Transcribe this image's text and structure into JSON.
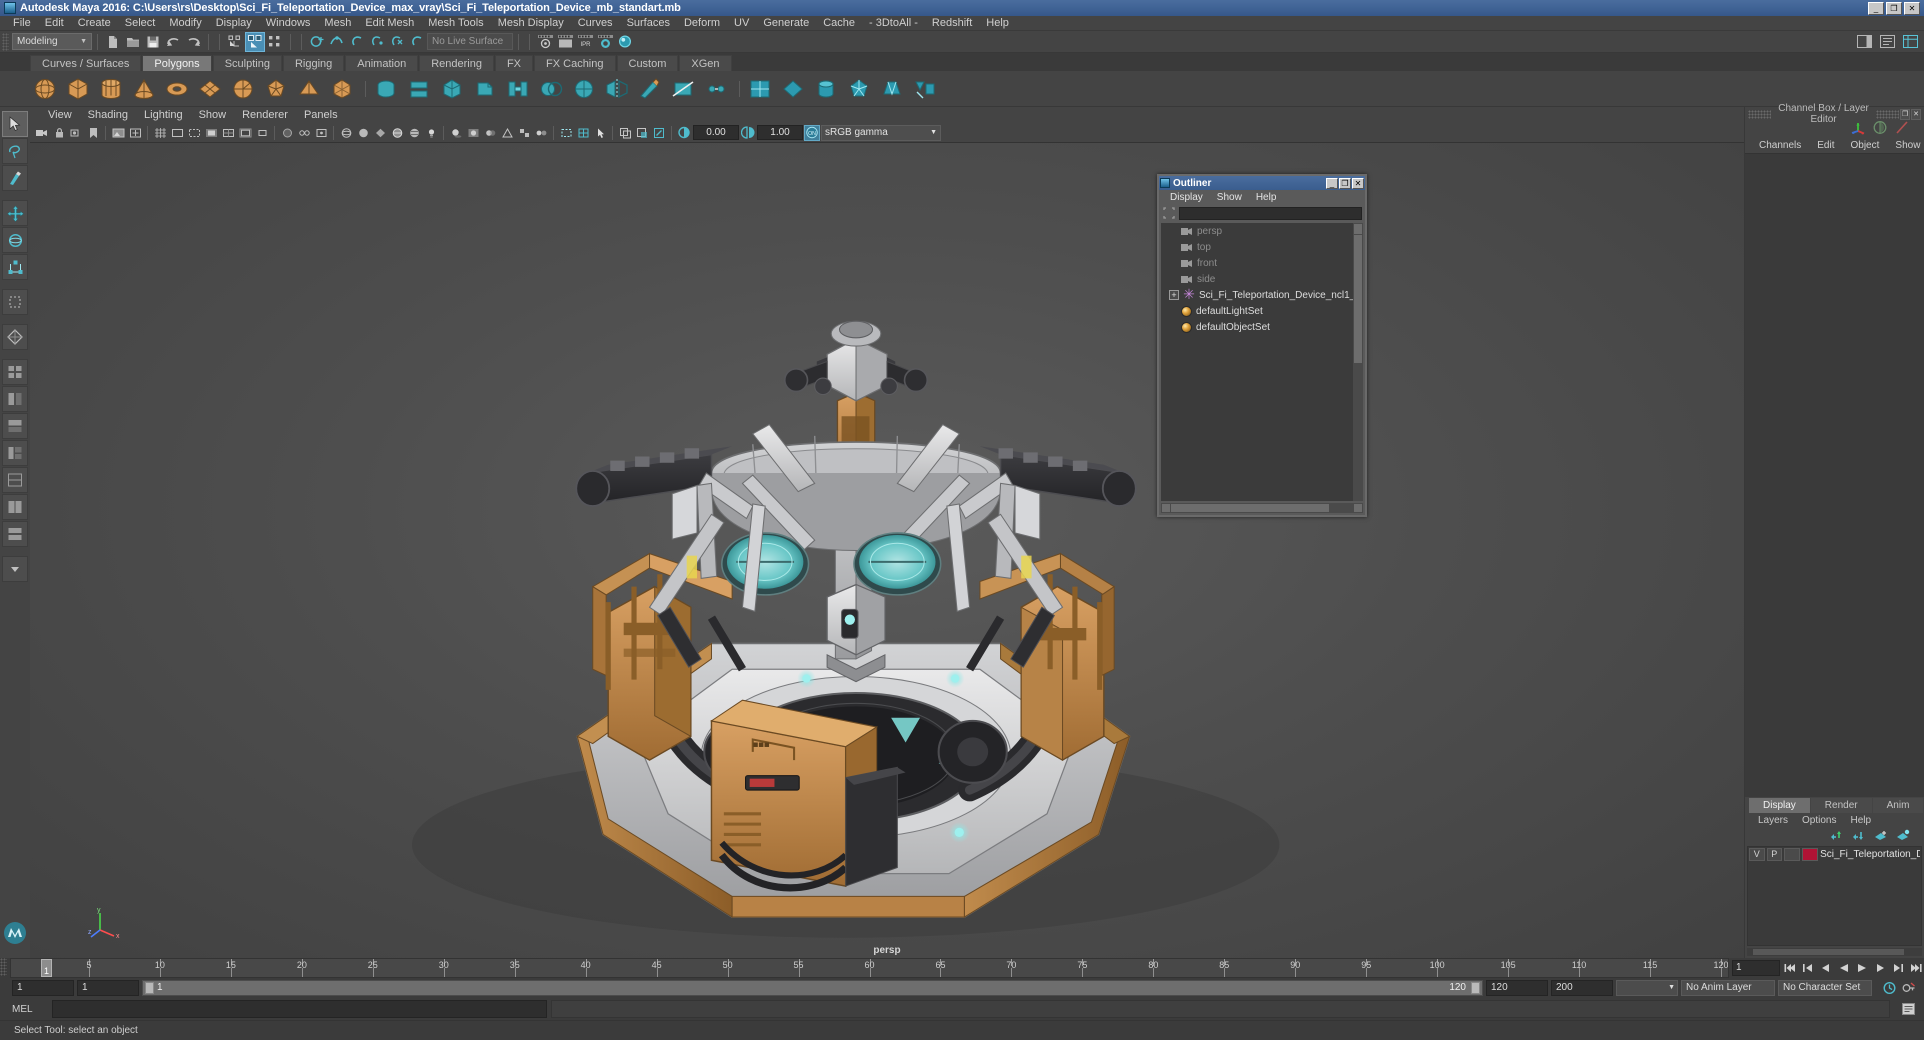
{
  "window": {
    "title": "Autodesk Maya 2016: C:\\Users\\rs\\Desktop\\Sci_Fi_Teleportation_Device_max_vray\\Sci_Fi_Teleportation_Device_mb_standart.mb",
    "buttons": [
      "_",
      "❐",
      "✕"
    ],
    "icon": "maya-app-icon"
  },
  "main_menu": {
    "items": [
      "File",
      "Edit",
      "Create",
      "Select",
      "Modify",
      "Display",
      "Windows",
      "Mesh",
      "Edit Mesh",
      "Mesh Tools",
      "Mesh Display",
      "Curves",
      "Surfaces",
      "Deform",
      "UV",
      "Generate",
      "Cache",
      "- 3DtoAll -",
      "Redshift",
      "Help"
    ]
  },
  "status_toolbar": {
    "menuset": {
      "value": "Modeling",
      "arrow": "▼"
    },
    "live_surface": {
      "value": "No Live Surface"
    },
    "icons": [
      "new-scene-icon",
      "open-scene-icon",
      "save-scene-icon",
      "undo-icon",
      "redo-icon",
      "select-by-hierarchy-icon",
      "select-by-object-icon",
      "select-by-component-icon",
      "snap-to-grid-icon",
      "snap-to-curve-icon",
      "snap-to-point-icon",
      "snap-to-projected-center-icon",
      "snap-to-view-plane-icon",
      "make-live-icon",
      "render-view-icon",
      "render-sequence-icon",
      "ipr-render-icon",
      "render-settings-icon",
      "hypershade-icon"
    ],
    "right_icons": [
      "sidebar-toggle-icon",
      "attribute-editor-icon",
      "tool-settings-icon",
      "channel-box-icon"
    ]
  },
  "shelf": {
    "tabs": [
      "Curves / Surfaces",
      "Polygons",
      "Sculpting",
      "Rigging",
      "Animation",
      "Rendering",
      "FX",
      "FX Caching",
      "Custom",
      "XGen"
    ],
    "active_tab": "Polygons",
    "icons": [
      "poly-sphere-icon",
      "poly-cube-icon",
      "poly-cylinder-icon",
      "poly-cone-icon",
      "poly-torus-icon",
      "poly-plane-icon",
      "poly-disc-icon",
      "poly-platonic-icon",
      "poly-pyramid-icon",
      "poly-prism-icon",
      "combine-icon",
      "separate-icon",
      "extrude-icon",
      "bevel-icon",
      "bridge-icon",
      "booleans-icon",
      "smooth-icon",
      "mirror-icon",
      "sculpt-icon",
      "soft-select-icon",
      "poly-fill-hole-icon",
      "multi-cut-icon",
      "target-weld-icon",
      "quad-draw-icon",
      "crease-icon",
      "insert-edge-loop-icon",
      "offset-edge-loop-icon",
      "uv-editor-icon",
      "uv-planar-icon",
      "uv-cylindrical-icon",
      "uv-spherical-icon",
      "uv-automatic-icon",
      "uv-unfold-icon",
      "uv-layout-icon"
    ]
  },
  "toolbox": {
    "items": [
      {
        "name": "select-tool",
        "selected": true
      },
      {
        "name": "lasso-select-tool",
        "selected": false
      },
      {
        "name": "paint-select-tool",
        "selected": false
      },
      {
        "name": "move-tool",
        "selected": false
      },
      {
        "name": "rotate-tool",
        "selected": false
      },
      {
        "name": "scale-tool",
        "selected": false
      },
      {
        "name": "last-tool-used",
        "selected": false
      },
      {
        "name": "single-perspective-view-layout",
        "selected": false
      },
      {
        "name": "four-view-layout",
        "selected": false
      },
      {
        "name": "persp-outliner-layout",
        "selected": false
      },
      {
        "name": "persp-graph-layout",
        "selected": false
      },
      {
        "name": "persp-hypershade-layout",
        "selected": false
      },
      {
        "name": "persp-uv-layout",
        "selected": false
      },
      {
        "name": "two-pane-side-layout",
        "selected": false
      },
      {
        "name": "two-pane-stacked-layout",
        "selected": false
      },
      {
        "name": "more-layouts",
        "selected": false
      }
    ]
  },
  "viewport": {
    "panel_menu": [
      "View",
      "Shading",
      "Lighting",
      "Show",
      "Renderer",
      "Panels"
    ],
    "camera_label": "persp",
    "toolbar": {
      "exposure_value": "0.00",
      "gamma_value": "1.00",
      "color_management": "sRGB gamma",
      "cm_arrow": "▼",
      "toggle_on_label": "ON",
      "icons": [
        "select-camera-icon",
        "lock-camera-icon",
        "camera-attributes-icon",
        "bookmarks-icon",
        "image-plane-icon",
        "two-d-pan-zoom-icon",
        "grid-toggle-icon",
        "film-gate-icon",
        "resolution-gate-icon",
        "gate-mask-icon",
        "field-chart-icon",
        "safe-action-icon",
        "safe-title-icon",
        "xray-icon",
        "xray-joints-icon",
        "xray-active-components-icon",
        "shadows-icon",
        "ao-icon",
        "motion-blur-icon",
        "anti-alias-icon",
        "multisample-icon",
        "depth-of-field-icon",
        "isolate-select-icon",
        "wireframe-icon",
        "smooth-shade-icon",
        "flat-shade-icon",
        "wireframe-on-shaded-icon",
        "textured-icon",
        "lights-icon",
        "exposure-icon",
        "contrast-icon",
        "color-management-toggle-icon"
      ]
    },
    "axis_gizmo": {
      "x": "x",
      "y": "y",
      "z": "z"
    }
  },
  "outliner": {
    "title": "Outliner",
    "window_buttons": [
      "_",
      "❐",
      "✕"
    ],
    "menu": [
      "Display",
      "Show",
      "Help"
    ],
    "search_value": "",
    "search_icon": "selection-filter-icon",
    "items": [
      {
        "label": "persp",
        "icon": "camera-icon",
        "dim": true,
        "expand": false
      },
      {
        "label": "top",
        "icon": "camera-icon",
        "dim": true,
        "expand": false
      },
      {
        "label": "front",
        "icon": "camera-icon",
        "dim": true,
        "expand": false
      },
      {
        "label": "side",
        "icon": "camera-icon",
        "dim": true,
        "expand": false
      },
      {
        "label": "Sci_Fi_Teleportation_Device_ncl1_",
        "icon": "transform-group-icon",
        "dim": false,
        "expand": true
      },
      {
        "label": "defaultLightSet",
        "icon": "set-icon",
        "dim": false,
        "expand": false
      },
      {
        "label": "defaultObjectSet",
        "icon": "set-icon",
        "dim": false,
        "expand": false
      }
    ]
  },
  "channel_box": {
    "title": "Channel Box / Layer Editor",
    "header_buttons": [
      "❐",
      "✕"
    ],
    "tool_icons": [
      "channel-box-icon",
      "attribute-editor-icon",
      "modeling-toolkit-icon"
    ],
    "menu": [
      "Channels",
      "Edit",
      "Object",
      "Show"
    ]
  },
  "layer_editor": {
    "tabs": [
      "Display",
      "Render",
      "Anim"
    ],
    "active_tab": "Display",
    "menu": [
      "Layers",
      "Options",
      "Help"
    ],
    "buttons": [
      "move-layer-up-icon",
      "move-layer-down-icon",
      "new-layer-icon",
      "new-layer-from-selected-icon"
    ],
    "layers": [
      {
        "visible": "V",
        "playback": "P",
        "type": "",
        "color": "#b01335",
        "name": "Sci_Fi_Teleportation_D"
      }
    ]
  },
  "timeline": {
    "ticks": [
      5,
      10,
      15,
      20,
      25,
      30,
      35,
      40,
      45,
      50,
      55,
      60,
      65,
      70,
      75,
      80,
      85,
      90,
      95,
      100,
      105,
      110,
      115,
      120
    ],
    "range_start": 1,
    "range_end": 120,
    "current_frame": "1",
    "current_frame_label": "1",
    "current_frame_field": "1",
    "playback_buttons": [
      "go-to-start-icon",
      "step-back-key-icon",
      "step-back-frame-icon",
      "play-backwards-icon",
      "play-forwards-icon",
      "step-forward-frame-icon",
      "step-forward-key-icon",
      "go-to-end-icon"
    ],
    "range_fields": {
      "anim_start": "1",
      "range_start": "1",
      "slider_start_label": "1",
      "slider_end_label": "120",
      "range_end": "120",
      "anim_end": "200"
    },
    "anim_layer": {
      "value": "No Anim Layer",
      "arrow": "▼"
    },
    "character_set": {
      "value": "No Character Set"
    },
    "right_icons": [
      "animation-preferences-icon",
      "auto-key-icon"
    ]
  },
  "command_line": {
    "label": "MEL",
    "input_value": "",
    "output_value": ""
  },
  "status_line": {
    "text": "Select Tool: select an object"
  },
  "colors": {
    "title_bar": "#3f6294",
    "accent": "#4a8fb5",
    "shelf_orange": "#d89a55",
    "teal": "#3aa8b5",
    "layer_swatch": "#b01335"
  }
}
